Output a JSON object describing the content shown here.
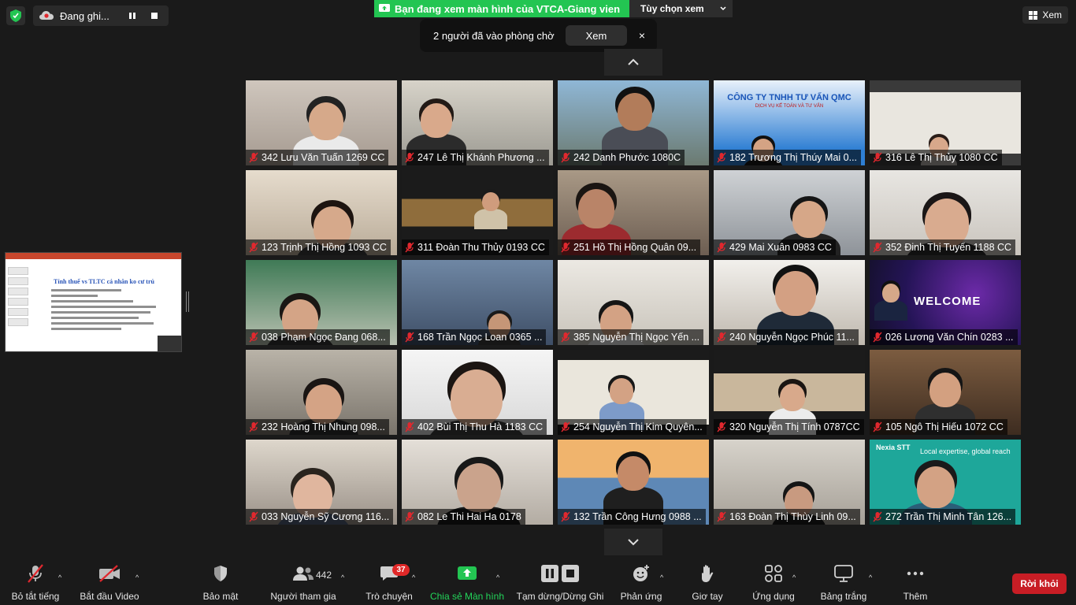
{
  "top": {
    "recording_label": "Đang ghi...",
    "share_banner_text": "Bạn đang xem màn hình của VTCA-Giang vien",
    "view_options_label": "Tùy chọn xem",
    "waiting_room_text": "2 người đã vào phòng chờ",
    "waiting_view_button": "Xem",
    "waiting_close": "×",
    "view_label": "Xem"
  },
  "shared_slide": {
    "title": "Tính thuế vs TLTC cá nhân ko cư trú"
  },
  "participants": [
    {
      "name": "342 Lưu Văn Tuấn 1269 CC",
      "muted": true
    },
    {
      "name": "247 Lê Thị Khánh Phương ...",
      "muted": true
    },
    {
      "name": "242 Danh Phước 1080C",
      "muted": true
    },
    {
      "name": "182 Trương Thị Thúy Mai 0...",
      "muted": true
    },
    {
      "name": "316 Lê Thị Thủy 1080 CC",
      "muted": true
    },
    {
      "name": "123 Trịnh Thị Hồng 1093 CC",
      "muted": true
    },
    {
      "name": "311 Đoàn Thu Thủy 0193 CC",
      "muted": true
    },
    {
      "name": "251 Hồ Thị Hồng Quân 09...",
      "muted": true
    },
    {
      "name": "429 Mai Xuân 0983 CC",
      "muted": true
    },
    {
      "name": "352 Đinh Thị Tuyến 1188 CC",
      "muted": true
    },
    {
      "name": "038 Phạm Ngọc Đang 068...",
      "muted": true
    },
    {
      "name": "168 Trần Ngọc Loan 0365 ...",
      "muted": true
    },
    {
      "name": "385 Nguyễn Thị Ngọc Yến ...",
      "muted": true
    },
    {
      "name": "240 Nguyễn Ngọc Phúc 11...",
      "muted": true
    },
    {
      "name": "026 Lương Văn Chín 0283 ...",
      "muted": true
    },
    {
      "name": "232 Hoàng Thị Nhung 098...",
      "muted": true
    },
    {
      "name": "402 Bùi Thị Thu Hà 1183 CC",
      "muted": true
    },
    {
      "name": "254 Nguyễn Thị Kim Quyên...",
      "muted": true
    },
    {
      "name": "320 Nguyễn Thị Tính 0787CC",
      "muted": true
    },
    {
      "name": "105 Ngô Thị Hiếu 1072 CC",
      "muted": true
    },
    {
      "name": "033 Nguyễn Sỹ Cương 116...",
      "muted": true
    },
    {
      "name": "082 Le Thi Hai Ha 0178",
      "muted": true
    },
    {
      "name": "132 Trần Công Hưng 0988 ...",
      "muted": true
    },
    {
      "name": "163 Đoàn Thị Thùy Linh 09...",
      "muted": true
    },
    {
      "name": "272 Trần Thị Minh Tân 126...",
      "muted": true
    }
  ],
  "tiles_text": {
    "qmc_title": "CÔNG TY TNHH TƯ VẤN QMC",
    "qmc_sub": "DỊCH VỤ KẾ TOÁN VÀ TƯ VẤN",
    "welcome": "WELCOME",
    "nexia_brand": "Nexia STT",
    "nexia_slogan": "Local expertise, global reach"
  },
  "toolbar": {
    "mute_label": "Bỏ tắt tiếng",
    "video_label": "Bắt đầu Video",
    "security_label": "Bảo mật",
    "participants_label": "Người tham gia",
    "participants_count": "442",
    "chat_label": "Trò chuyện",
    "chat_badge": "37",
    "share_label": "Chia sẻ Màn hình",
    "pause_label": "Tạm dừng/Dừng Ghi",
    "reactions_label": "Phản ứng",
    "raise_hand_label": "Giơ tay",
    "apps_label": "Ứng dụng",
    "whiteboard_label": "Bảng trắng",
    "more_label": "Thêm",
    "leave_label": "Rời khỏi"
  },
  "colors": {
    "accent_green": "#23c552",
    "leave_red": "#c81d25",
    "badge_red": "#e02828",
    "mute_red": "#e0282e"
  }
}
